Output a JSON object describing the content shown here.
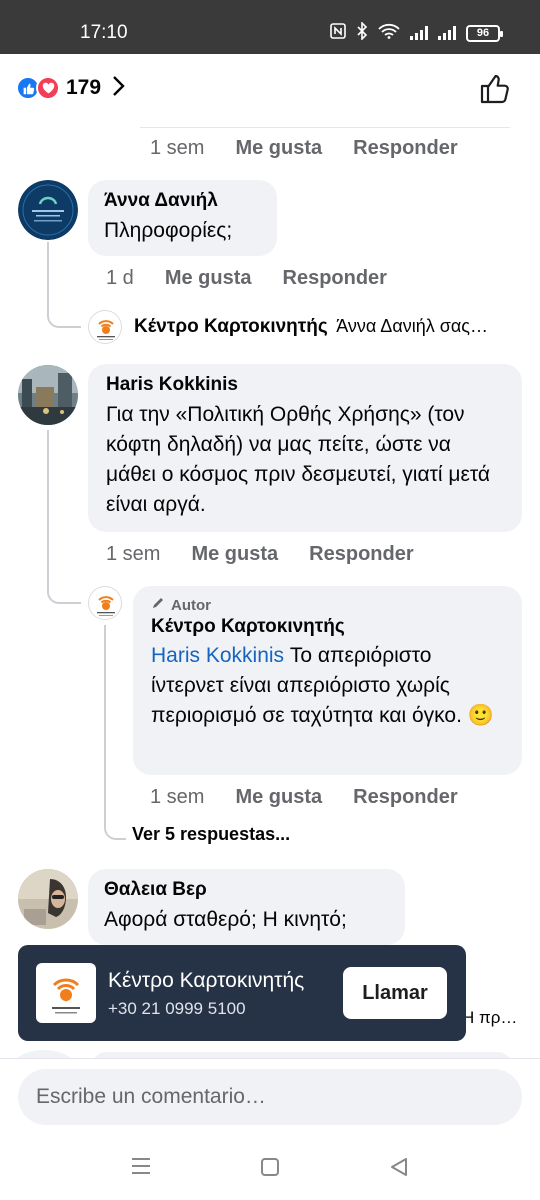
{
  "status_bar": {
    "time": "17:10",
    "battery": "96"
  },
  "reactions": {
    "count": "179"
  },
  "top_meta": {
    "time": "1 sem",
    "like": "Me gusta",
    "reply": "Responder"
  },
  "comments": [
    {
      "author": "Άννα Δανιήλ",
      "text": "Πληροφορίες;",
      "time": "1 d",
      "like": "Me gusta",
      "reply": "Responder",
      "reply_preview": {
        "author": "Κέντρο Καρτοκινητής",
        "snippet": "Άννα Δανιήλ σας…"
      }
    },
    {
      "author": "Haris Kokkinis",
      "text": "Για την «Πολιτική Ορθής Χρήσης» (τον κόφτη δηλαδή) να μας πείτε, ώστε να μάθει ο κόσμος πριν δεσμευτεί, γιατί μετά είναι αργά.",
      "time": "1 sem",
      "like": "Me gusta",
      "reply": "Responder",
      "author_reply": {
        "badge": "Autor",
        "author": "Κέντρο Καρτοκινητής",
        "mention": "Haris Kokkinis",
        "text": " Το απεριόριστο ίντερνετ είναι απεριόριστο χωρίς περιορισμό σε ταχύτητα και όγκο. 🙂",
        "time": "1 sem",
        "like": "Me gusta",
        "reply": "Responder"
      },
      "more_replies": "Ver 5 respuestas..."
    },
    {
      "author": "Θαλεια Βερ",
      "text": "Αφορά σταθερό; Η κινητό;",
      "hidden_snippet": "Η πρ…"
    }
  ],
  "call_card": {
    "page_name": "Κέντρο Καρτοκινητής",
    "phone": "+30 21 0999 5100",
    "button": "Llamar"
  },
  "composer": {
    "placeholder": "Escribe un comentario…"
  },
  "colors": {
    "status_bar": "#3a3a3a",
    "link_blue": "#1565c0",
    "call_card": "#263246",
    "bubble": "#f0f2f5"
  }
}
